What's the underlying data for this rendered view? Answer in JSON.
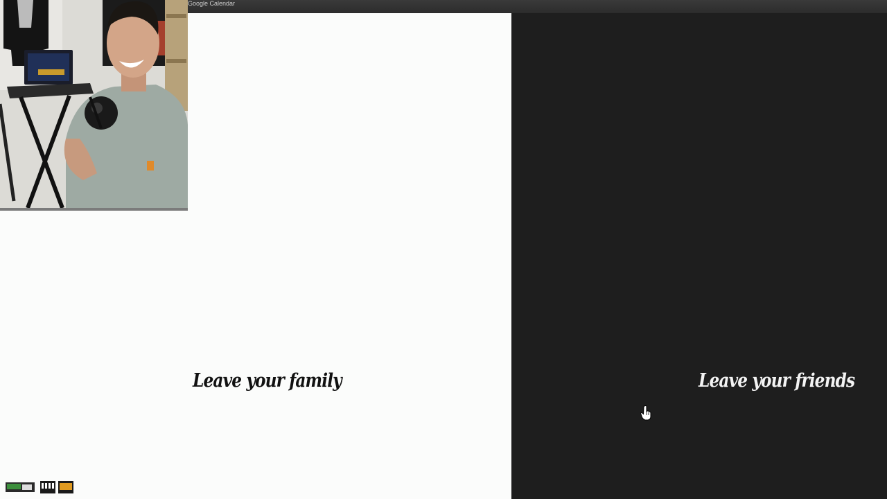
{
  "browser": {
    "tab_title": "Google Calendar"
  },
  "choices": {
    "left": {
      "label": "Leave your family",
      "background": "#fbfcfb",
      "text_color": "#111111"
    },
    "right": {
      "label": "Leave your friends",
      "background": "#1e1e1e",
      "text_color": "#f4f4f4"
    }
  },
  "webcam": {
    "icon": "webcam-person-icon"
  },
  "cursor": {
    "icon": "hand-pointer-icon"
  },
  "taskbar": {
    "icons": [
      "app-icon-green",
      "app-icon-keyboard",
      "app-icon-orange"
    ]
  }
}
